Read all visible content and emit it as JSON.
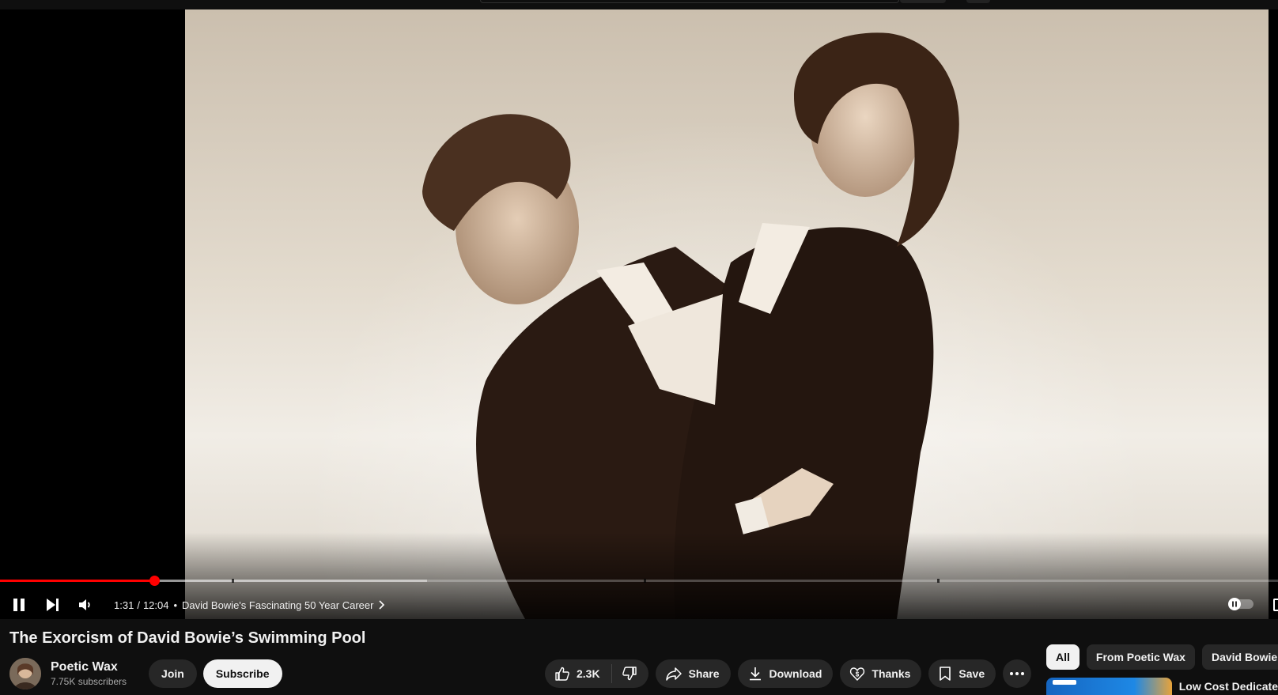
{
  "video": {
    "title": "The Exorcism of David Bowie’s Swimming Pool",
    "current_time": "1:31",
    "duration": "12:04",
    "time_separator": "/",
    "chapter_separator": "•",
    "chapter_title": "David Bowie's Fascinating 50 Year Career",
    "played_fraction": 0.1205,
    "buffered_fraction": 0.334,
    "chapter_markers": [
      0.1815,
      0.5035,
      0.7335
    ],
    "autoplay": true
  },
  "channel": {
    "name": "Poetic Wax",
    "subscribers": "7.75K subscribers",
    "join_label": "Join",
    "subscribe_label": "Subscribe"
  },
  "actions": {
    "like_count": "2.3K",
    "share_label": "Share",
    "download_label": "Download",
    "thanks_label": "Thanks",
    "save_label": "Save"
  },
  "chips": [
    "All",
    "From Poetic Wax",
    "David Bowie"
  ],
  "recommended": {
    "title": "Low Cost Dedicate"
  },
  "colors": {
    "accent": "#ff0000",
    "background": "#0f0f0f",
    "pill": "#272727"
  },
  "icons": {
    "play_pause": "pause-icon",
    "next": "next-icon",
    "volume": "volume-icon",
    "like": "thumbs-up-icon",
    "dislike": "thumbs-down-icon",
    "share": "share-icon",
    "download": "download-icon",
    "thanks": "thanks-icon",
    "save": "bookmark-icon",
    "more": "more-icon"
  }
}
